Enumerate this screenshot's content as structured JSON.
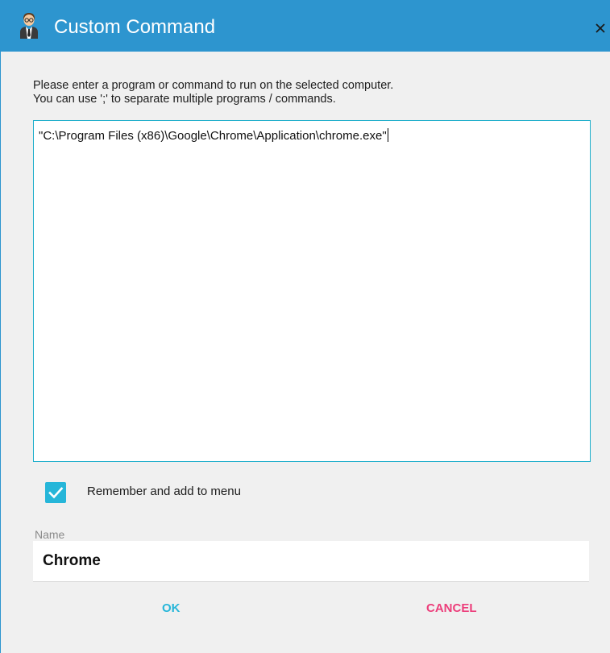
{
  "window": {
    "title": "Custom Command",
    "icon": "user-agent-icon",
    "close_icon": "close-icon",
    "accent_color": "#2d95cf"
  },
  "instructions": {
    "line1": "Please enter a program or command to run on the selected computer.",
    "line2": "You can use ';' to separate multiple programs / commands."
  },
  "command": {
    "value": "\"C:\\Program Files (x86)\\Google\\Chrome\\Application\\chrome.exe\""
  },
  "remember": {
    "checked": true,
    "label": "Remember and add to menu",
    "color": "#26b6d9"
  },
  "name": {
    "label": "Name",
    "value": "Chrome"
  },
  "buttons": {
    "ok_label": "OK",
    "ok_color": "#26b6d9",
    "cancel_label": "CANCEL",
    "cancel_color": "#ec3d7a"
  }
}
